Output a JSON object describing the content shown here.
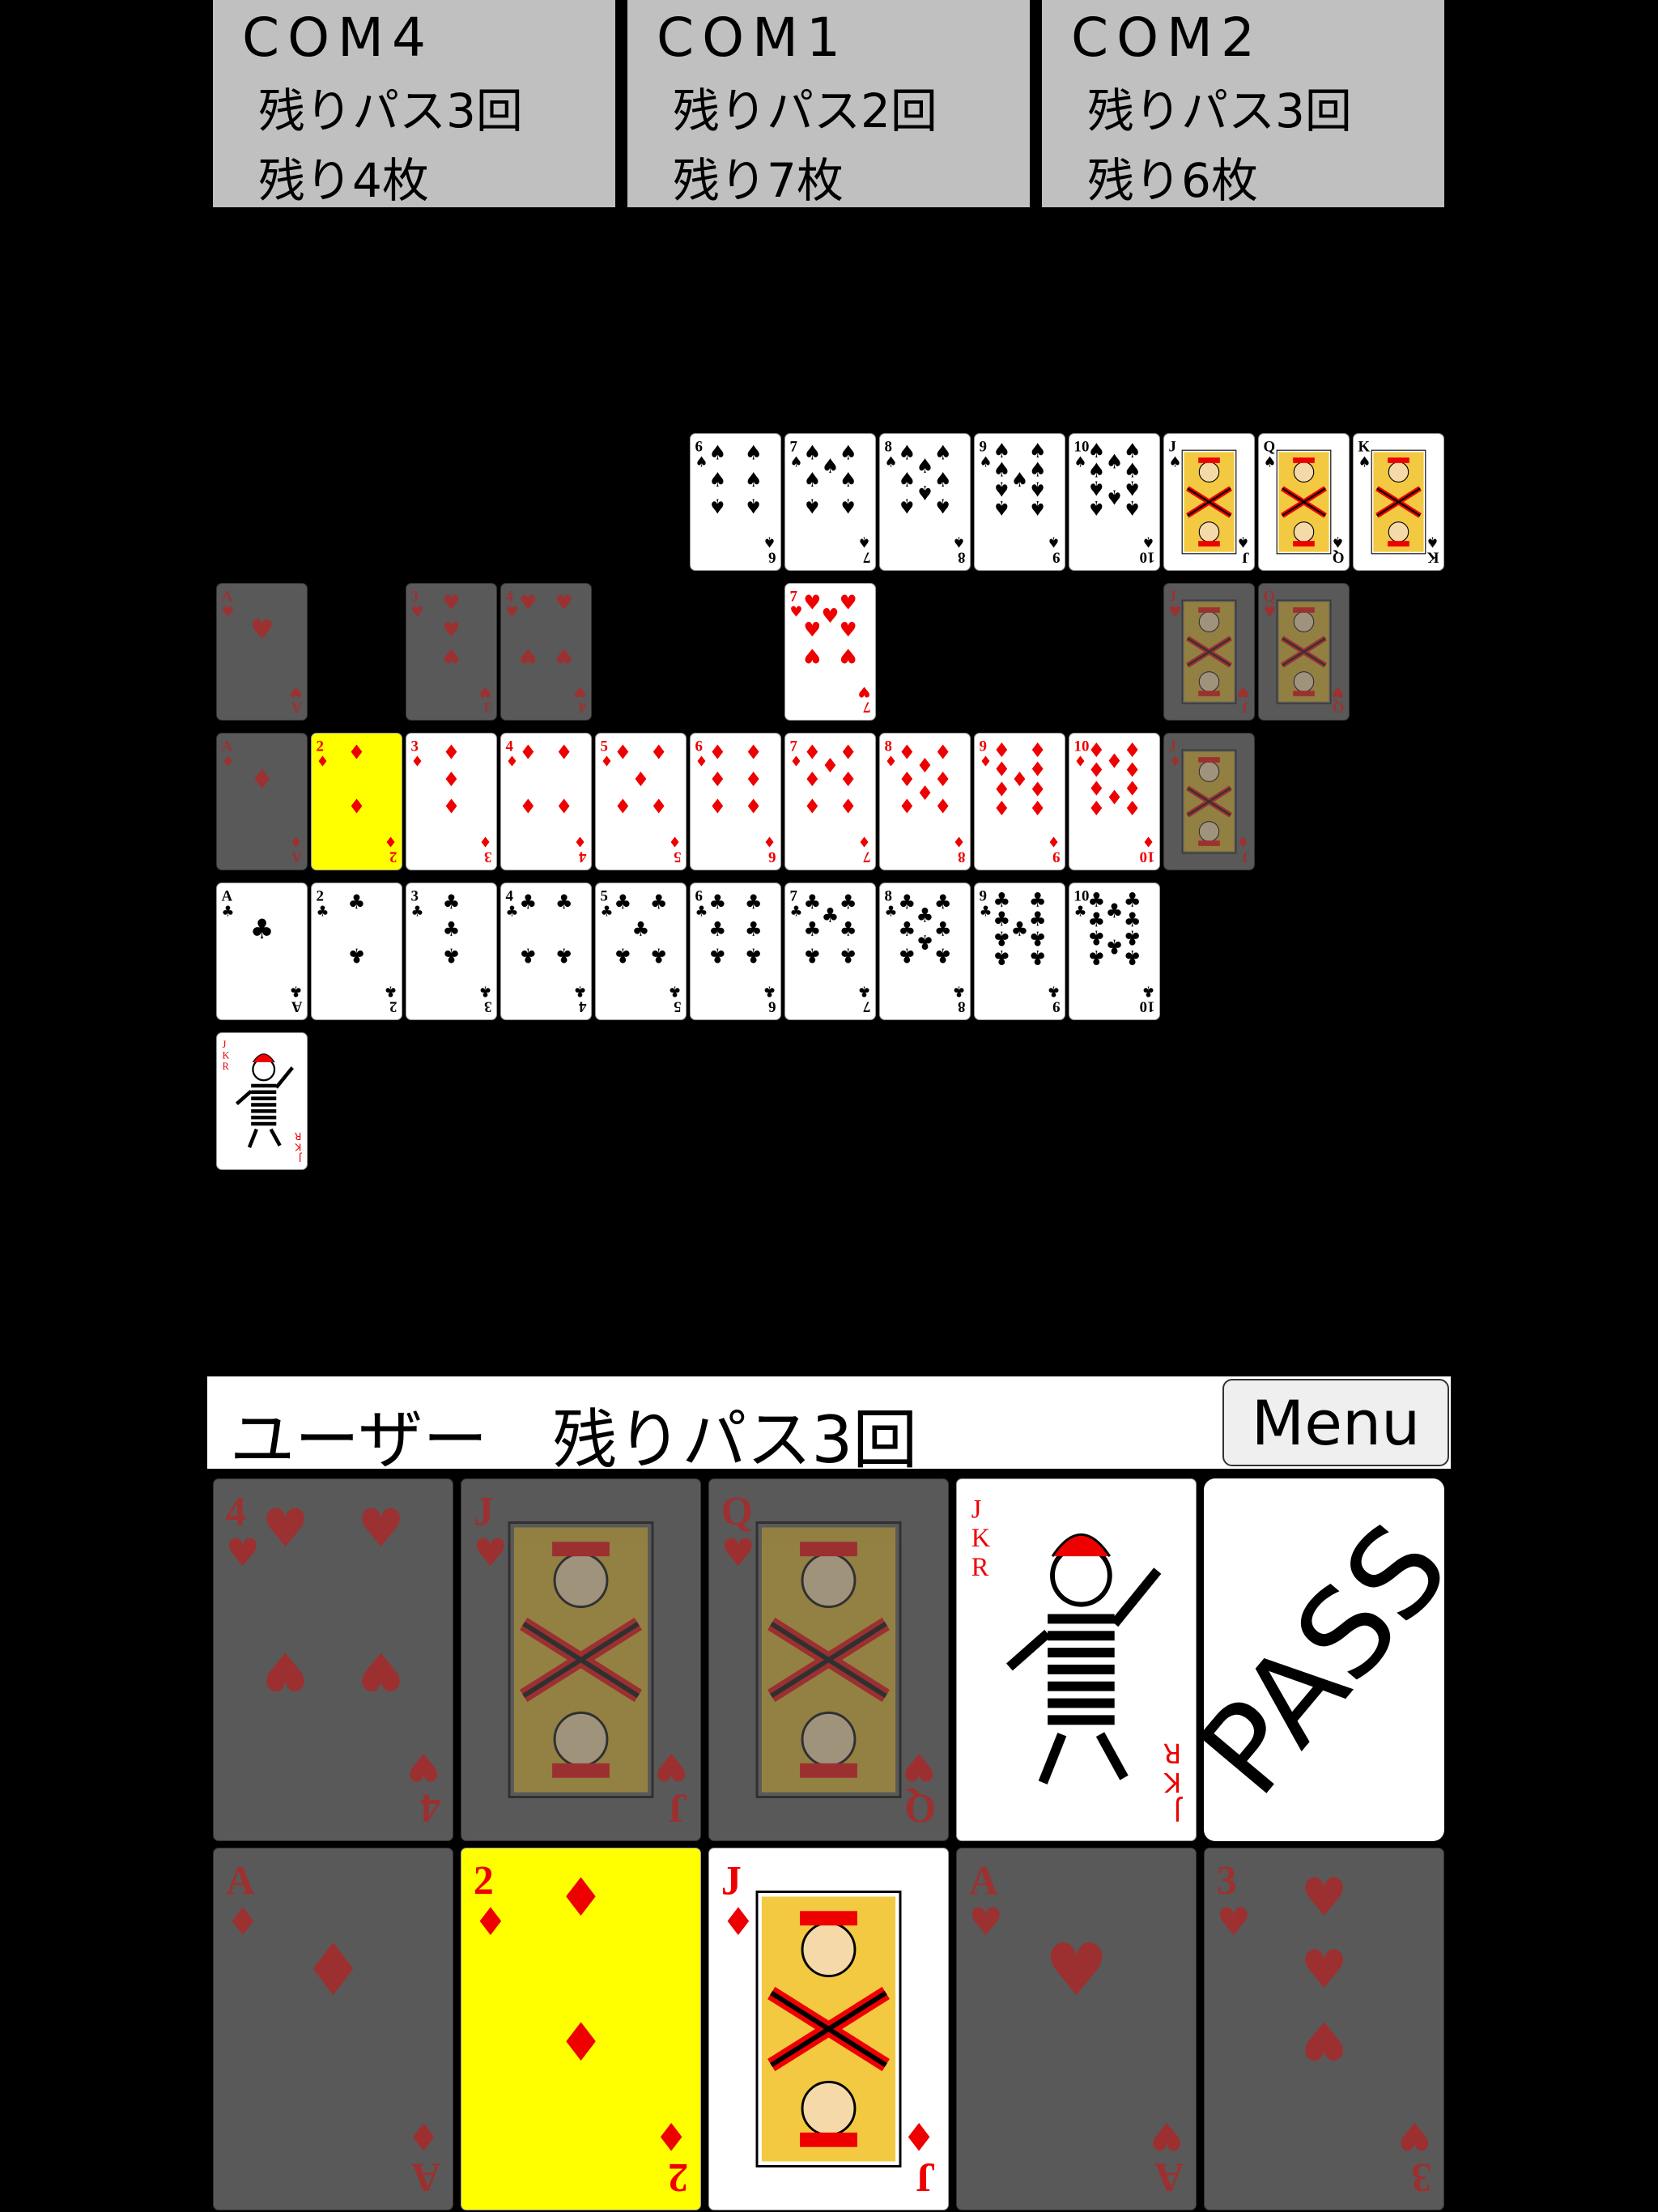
{
  "opponents": [
    {
      "name": "COM4",
      "passes": "残りパス3回",
      "cards": "残り4枚"
    },
    {
      "name": "COM1",
      "passes": "残りパス2回",
      "cards": "残り7枚"
    },
    {
      "name": "COM2",
      "passes": "残りパス3回",
      "cards": "残り6枚"
    }
  ],
  "board": {
    "spades": [
      {
        "rank": "6"
      },
      {
        "rank": "7"
      },
      {
        "rank": "8"
      },
      {
        "rank": "9"
      },
      {
        "rank": "10"
      },
      {
        "rank": "J"
      },
      {
        "rank": "Q"
      },
      {
        "rank": "K"
      }
    ],
    "hearts": [
      {
        "rank": "A",
        "state": "dim"
      },
      {
        "rank": "3",
        "state": "dim"
      },
      {
        "rank": "4",
        "state": "dim"
      },
      {
        "rank": "7"
      },
      {
        "rank": "J",
        "state": "dim"
      },
      {
        "rank": "Q",
        "state": "dim"
      }
    ],
    "diamonds": [
      {
        "rank": "A",
        "state": "dim"
      },
      {
        "rank": "2",
        "state": "sel"
      },
      {
        "rank": "3"
      },
      {
        "rank": "4"
      },
      {
        "rank": "5"
      },
      {
        "rank": "6"
      },
      {
        "rank": "7"
      },
      {
        "rank": "8"
      },
      {
        "rank": "9"
      },
      {
        "rank": "10"
      },
      {
        "rank": "J",
        "state": "dim"
      }
    ],
    "clubs": [
      {
        "rank": "A"
      },
      {
        "rank": "2"
      },
      {
        "rank": "3"
      },
      {
        "rank": "4"
      },
      {
        "rank": "5"
      },
      {
        "rank": "6"
      },
      {
        "rank": "7"
      },
      {
        "rank": "8"
      },
      {
        "rank": "9"
      },
      {
        "rank": "10"
      }
    ],
    "joker": [
      {
        "rank": "JOKER"
      }
    ]
  },
  "status": {
    "player": "ユーザー　残りパス3回",
    "menu_label": "Menu"
  },
  "hand": [
    {
      "rank": "4",
      "suit": "hearts",
      "state": "dim"
    },
    {
      "rank": "J",
      "suit": "hearts",
      "state": "dim"
    },
    {
      "rank": "Q",
      "suit": "hearts",
      "state": "dim"
    },
    {
      "rank": "JOKER",
      "suit": "joker"
    },
    {
      "rank": "A",
      "suit": "diamonds",
      "state": "dim"
    },
    {
      "rank": "2",
      "suit": "diamonds",
      "state": "sel"
    },
    {
      "rank": "J",
      "suit": "diamonds"
    },
    {
      "rank": "A",
      "suit": "hearts",
      "state": "dim"
    },
    {
      "rank": "3",
      "suit": "hearts",
      "state": "dim"
    }
  ],
  "pass_label": "PASS",
  "colors": {
    "background": "#000000",
    "panel": "#c0c0c0",
    "selected": "#ffff00",
    "dimmed": "#595959",
    "red": "#ee0000",
    "black": "#000000"
  }
}
